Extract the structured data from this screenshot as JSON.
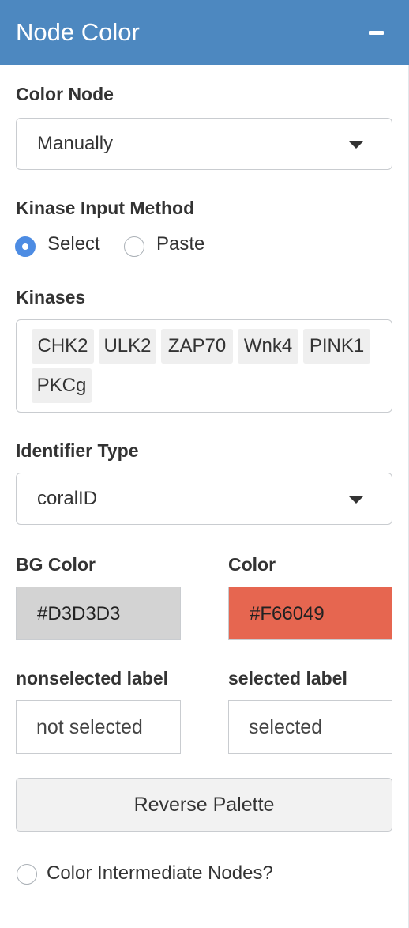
{
  "panel": {
    "title": "Node Color",
    "collapse_icon": "minus-icon"
  },
  "color_node": {
    "label": "Color Node",
    "selected": "Manually"
  },
  "kinase_input": {
    "label": "Kinase Input Method",
    "options": [
      {
        "label": "Select",
        "checked": true
      },
      {
        "label": "Paste",
        "checked": false
      }
    ]
  },
  "kinases": {
    "label": "Kinases",
    "items": [
      "CHK2",
      "ULK2",
      "ZAP70",
      "Wnk4",
      "PINK1",
      "PKCg"
    ]
  },
  "identifier_type": {
    "label": "Identifier Type",
    "selected": "coralID"
  },
  "bg_color": {
    "label": "BG Color",
    "value": "#D3D3D3",
    "swatch": "#d3d3d3"
  },
  "color": {
    "label": "Color",
    "value": "#F66049",
    "swatch": "#e66650"
  },
  "nonselected_label": {
    "label": "nonselected label",
    "value": "not selected"
  },
  "selected_label": {
    "label": "selected label",
    "value": "selected"
  },
  "reverse_palette": {
    "label": "Reverse Palette"
  },
  "intermediate_nodes": {
    "label": "Color Intermediate Nodes?",
    "checked": false
  },
  "theme": {
    "header_bg": "#4d88c0",
    "accent": "#4d8ce3"
  }
}
